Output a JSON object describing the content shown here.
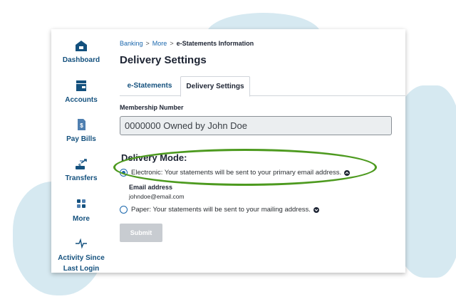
{
  "sidebar": {
    "items": [
      {
        "label": "Dashboard",
        "icon": "home-icon"
      },
      {
        "label": "Accounts",
        "icon": "wallet-icon"
      },
      {
        "label": "Pay Bills",
        "icon": "bill-icon"
      },
      {
        "label": "Transfers",
        "icon": "transfer-icon"
      },
      {
        "label": "More",
        "icon": "grid-icon"
      },
      {
        "label": "Activity Since Last Login",
        "icon": "activity-icon"
      }
    ]
  },
  "breadcrumb": {
    "banking": "Banking",
    "sep1": ">",
    "more": "More",
    "sep2": ">",
    "current": "e-Statements Information"
  },
  "page": {
    "title": "Delivery Settings"
  },
  "tabs": [
    {
      "label": "e-Statements",
      "active": false
    },
    {
      "label": "Delivery Settings",
      "active": true
    }
  ],
  "form": {
    "membership_label": "Membership Number",
    "membership_value": "0000000 Owned by John Doe",
    "delivery_mode_title": "Delivery Mode:",
    "options": [
      {
        "label": "Electronic: Your statements will be sent to your primary email address.",
        "selected": true
      },
      {
        "label": "Paper: Your statements will be sent to your mailing address.",
        "selected": false
      }
    ],
    "email_label": "Email address",
    "email_value": "johndoe@email.com",
    "submit_label": "Submit"
  },
  "colors": {
    "brand_blue": "#14517e",
    "link_blue": "#1a67ad",
    "highlight_green": "#4d9a1f",
    "background_blob": "#d6e9f1"
  }
}
